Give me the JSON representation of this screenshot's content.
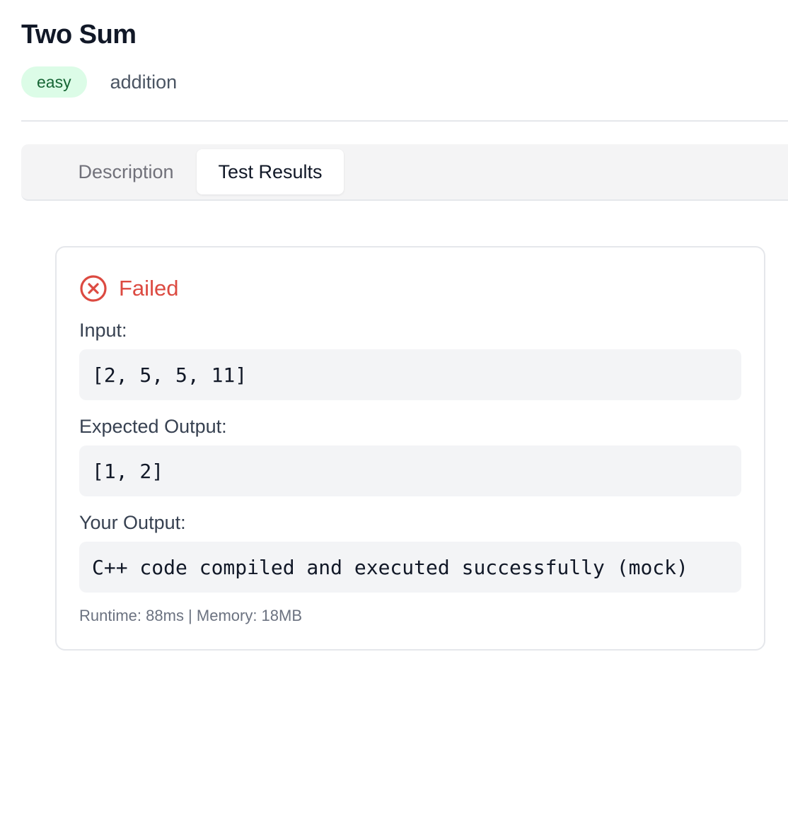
{
  "problem": {
    "title": "Two Sum",
    "difficulty": "easy",
    "tag": "addition"
  },
  "tabs": [
    {
      "label": "Description",
      "active": false
    },
    {
      "label": "Test Results",
      "active": true
    }
  ],
  "result": {
    "status": "Failed",
    "status_icon": "x-circle-icon",
    "input_label": "Input:",
    "input_value": "[2, 5, 5, 11]",
    "expected_label": "Expected Output:",
    "expected_value": "[1, 2]",
    "output_label": "Your Output:",
    "output_value": "C++ code compiled and executed successfully (mock)",
    "stats": "Runtime: 88ms | Memory: 18MB"
  },
  "colors": {
    "failed": "#dc4a41",
    "easy_badge_bg": "#dcfce7",
    "easy_badge_text": "#166534"
  }
}
